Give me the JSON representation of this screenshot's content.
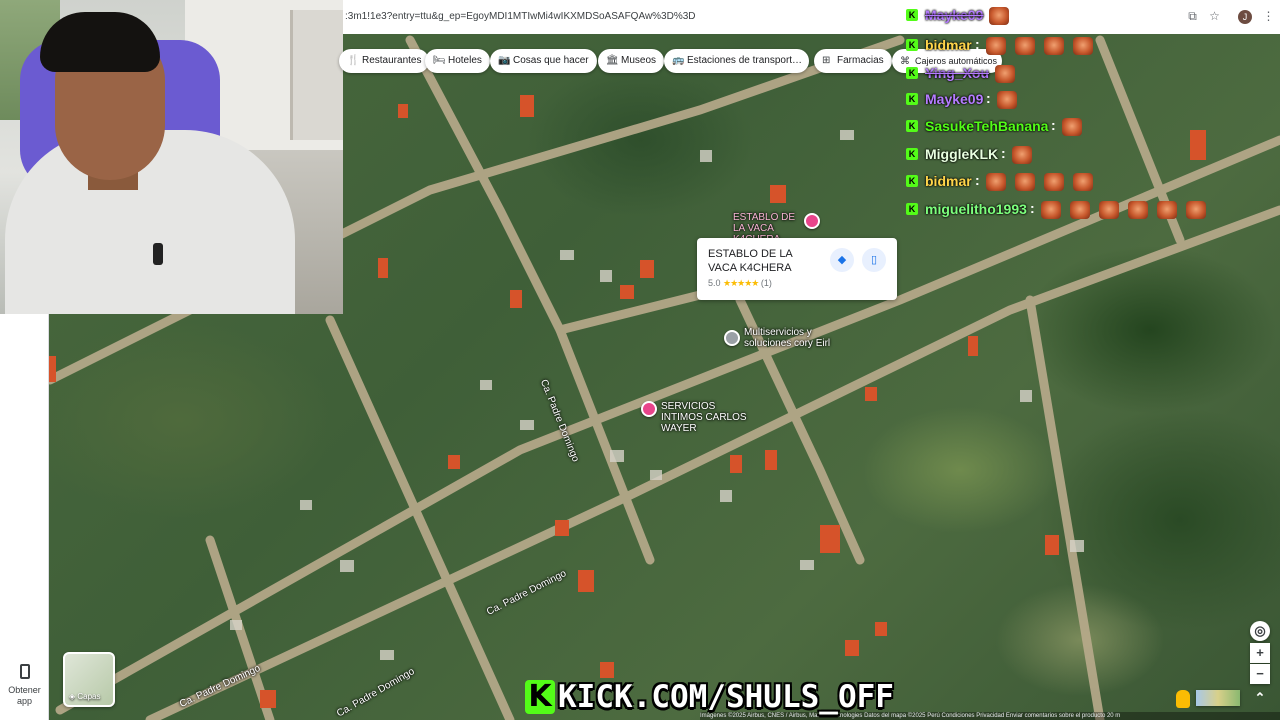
{
  "browser": {
    "url": ":3m1!1e3?entry=ttu&g_ep=EgoyMDI1MTIwMi4wIKXMDSoASAFQAw%3D%3D"
  },
  "chips": [
    {
      "icon": "fork-knife-icon",
      "glyph": "🍴",
      "label": "Restaurantes"
    },
    {
      "icon": "bed-icon",
      "glyph": "🛏",
      "label": "Hoteles"
    },
    {
      "icon": "camera-icon",
      "glyph": "📷",
      "label": "Cosas que hacer"
    },
    {
      "icon": "museum-icon",
      "glyph": "🏛",
      "label": "Museos"
    },
    {
      "icon": "bus-icon",
      "glyph": "🚌",
      "label": "Estaciones de transport…"
    },
    {
      "icon": "pharmacy-icon",
      "glyph": "⊞",
      "label": "Farmacias"
    },
    {
      "icon": "atm-icon",
      "glyph": "⌘",
      "label": "Cajeros automáticos"
    }
  ],
  "chat": [
    {
      "user": "Mayke09",
      "color": "#b57cff",
      "emotes": 1,
      "strike": true
    },
    {
      "user": "bidmar",
      "color": "#ffd54a",
      "emotes": 4
    },
    {
      "user": "Ying_Xou",
      "color": "#b57cff",
      "emotes": 1,
      "strike": true
    },
    {
      "user": "Mayke09",
      "color": "#b57cff",
      "emotes": 1
    },
    {
      "user": "SasukeTehBanana",
      "color": "#53fc18",
      "emotes": 1
    },
    {
      "user": "MiggleKLK",
      "color": "#e8ffe0",
      "emotes": 1
    },
    {
      "user": "bidmar",
      "color": "#ffd54a",
      "emotes": 4
    },
    {
      "user": "miguelitho1993",
      "color": "#7dff7d",
      "emotes": 6
    }
  ],
  "place_card": {
    "name": "ESTABLO DE LA VACA K4CHERA",
    "rating": "5.0",
    "stars": "★★★★★",
    "count": "(1)"
  },
  "map_labels": {
    "establo": "ESTABLO DE LA VACA K4CHERA",
    "multiservicios": "Multiservicios y soluciones cory Eirl",
    "servicios": "SERVICIOS INTIMOS CARLOS WAYER",
    "street1": "Ca. Padre Domingo",
    "street2": "Ca. Padre Domingo",
    "street3": "Ca. Padre Domingo",
    "street4": "Ca. Padre Domingo"
  },
  "rail": {
    "app_label": "Obtener app"
  },
  "layers": {
    "label": "Capas"
  },
  "attribution": "Imágenes ©2025 Airbus, CNES / Airbus, Maxar Technologies  Datos del mapa ©2025   Perú   Condiciones   Privacidad   Enviar comentarios sobre el producto   20 m",
  "banner": {
    "text": "KICK.COM/SHULS_OFF"
  },
  "colors": {
    "kick_green": "#53fc18",
    "maps_blue": "#1a73e8"
  }
}
